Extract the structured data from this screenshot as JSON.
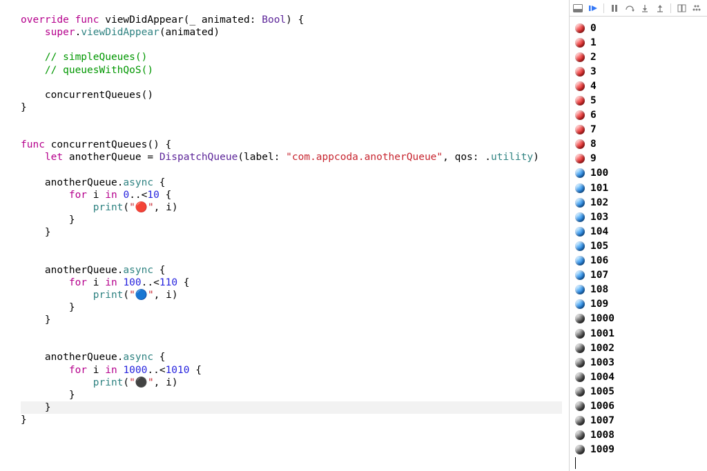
{
  "code": {
    "l1": {
      "override": "override",
      "func": "func",
      "name": "viewDidAppear",
      "params_open": "(",
      "underscore": "_",
      "pname": " animated: ",
      "ptype": "Bool",
      "params_close": ") {"
    },
    "l2": {
      "super": "super",
      "dot": ".",
      "call": "viewDidAppear",
      "args": "(animated)"
    },
    "l3": "// simpleQueues()",
    "l4": "// queuesWithQoS()",
    "l5": "concurrentQueues()",
    "l6": "}",
    "l7": {
      "func": "func",
      "name": "concurrentQueues",
      "rest": "() {"
    },
    "l8": {
      "let": "let",
      "lhs": " anotherQueue = ",
      "type": "DispatchQueue",
      "open": "(label: ",
      "str": "\"com.appcoda.anotherQueue\"",
      "mid": ", qos: .",
      "qos": "utility",
      "close": ")"
    },
    "l9": {
      "obj": "anotherQueue",
      "dot": ".",
      "method": "async",
      "brace": " {"
    },
    "l10": {
      "for": "for",
      "var": " i ",
      "in": "in",
      "space": " ",
      "n1": "0",
      "range": "..<",
      "n2": "10",
      "brace": " {"
    },
    "l11": {
      "print": "print",
      "open": "(",
      "str": "\"🔴\"",
      "comma": ", i)"
    },
    "l12": "}",
    "l13": "}",
    "l14": {
      "obj": "anotherQueue",
      "dot": ".",
      "method": "async",
      "brace": " {"
    },
    "l15": {
      "for": "for",
      "var": " i ",
      "in": "in",
      "space": " ",
      "n1": "100",
      "range": "..<",
      "n2": "110",
      "brace": " {"
    },
    "l16": {
      "print": "print",
      "open": "(",
      "str": "\"🔵\"",
      "comma": ", i)"
    },
    "l17": "}",
    "l18": "}",
    "l19": {
      "obj": "anotherQueue",
      "dot": ".",
      "method": "async",
      "brace": " {"
    },
    "l20": {
      "for": "for",
      "var": " i ",
      "in": "in",
      "space": " ",
      "n1": "1000",
      "range": "..<",
      "n2": "1010",
      "brace": " {"
    },
    "l21": {
      "print": "print",
      "open": "(",
      "str": "\"⚫️\"",
      "comma": ", i)"
    },
    "l22": "}",
    "l23": "}",
    "l24": "}"
  },
  "output": [
    {
      "c": "red",
      "v": "0"
    },
    {
      "c": "red",
      "v": "1"
    },
    {
      "c": "red",
      "v": "2"
    },
    {
      "c": "red",
      "v": "3"
    },
    {
      "c": "red",
      "v": "4"
    },
    {
      "c": "red",
      "v": "5"
    },
    {
      "c": "red",
      "v": "6"
    },
    {
      "c": "red",
      "v": "7"
    },
    {
      "c": "red",
      "v": "8"
    },
    {
      "c": "red",
      "v": "9"
    },
    {
      "c": "blue",
      "v": "100"
    },
    {
      "c": "blue",
      "v": "101"
    },
    {
      "c": "blue",
      "v": "102"
    },
    {
      "c": "blue",
      "v": "103"
    },
    {
      "c": "blue",
      "v": "104"
    },
    {
      "c": "blue",
      "v": "105"
    },
    {
      "c": "blue",
      "v": "106"
    },
    {
      "c": "blue",
      "v": "107"
    },
    {
      "c": "blue",
      "v": "108"
    },
    {
      "c": "blue",
      "v": "109"
    },
    {
      "c": "black",
      "v": "1000"
    },
    {
      "c": "black",
      "v": "1001"
    },
    {
      "c": "black",
      "v": "1002"
    },
    {
      "c": "black",
      "v": "1003"
    },
    {
      "c": "black",
      "v": "1004"
    },
    {
      "c": "black",
      "v": "1005"
    },
    {
      "c": "black",
      "v": "1006"
    },
    {
      "c": "black",
      "v": "1007"
    },
    {
      "c": "black",
      "v": "1008"
    },
    {
      "c": "black",
      "v": "1009"
    }
  ],
  "toolbar_icons": [
    "hide-icon",
    "play-icon",
    "pause-icon",
    "step-out-icon",
    "step-in-icon",
    "step-over-icon",
    "debug-view-icon",
    "breakpoints-icon"
  ]
}
